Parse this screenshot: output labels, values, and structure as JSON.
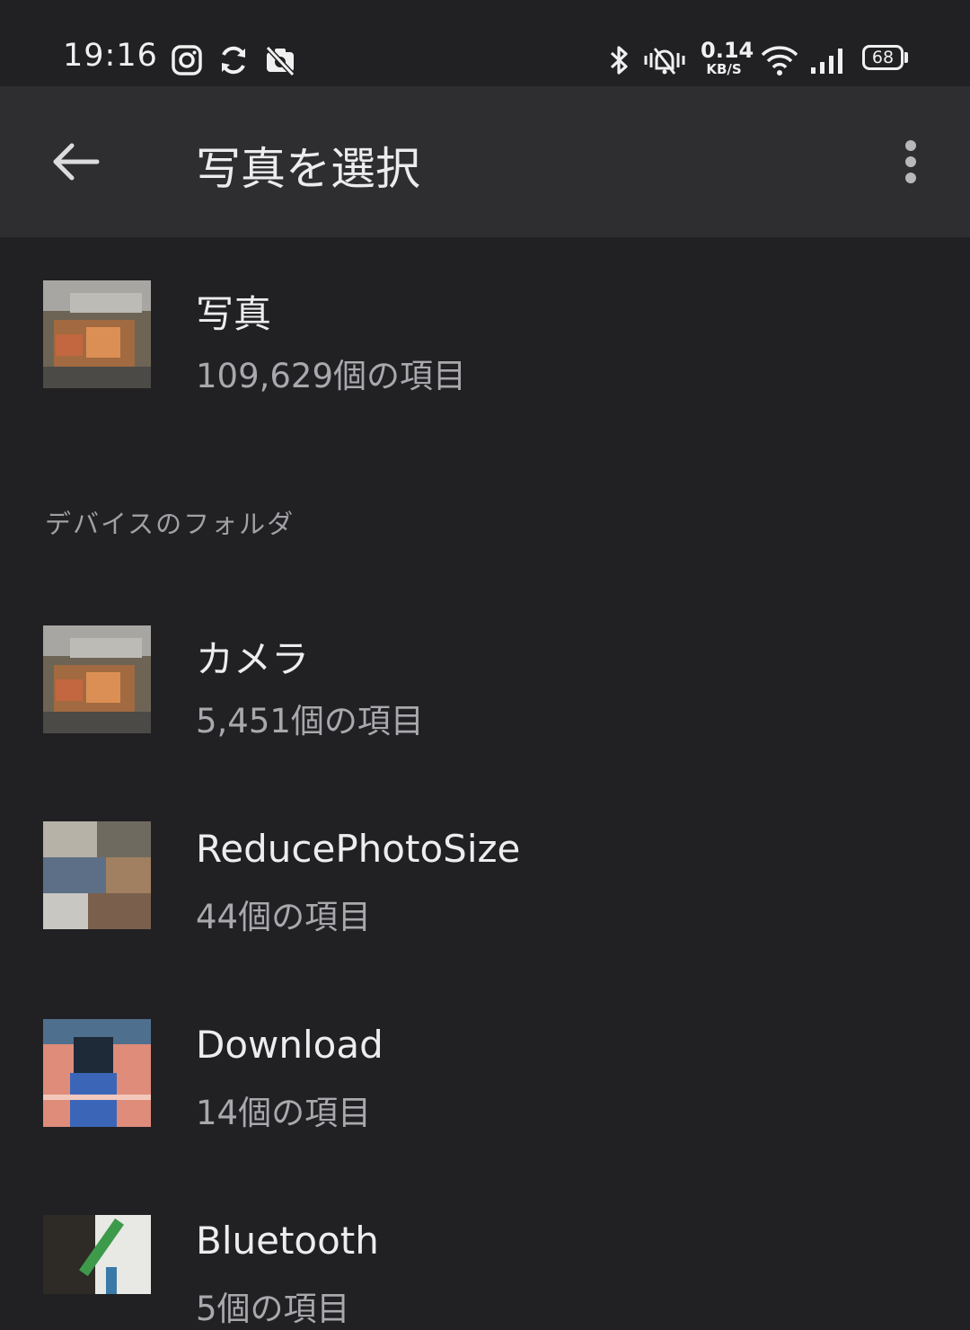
{
  "status_bar": {
    "time": "19:16",
    "left_icons": [
      "instagram-icon",
      "sync-icon",
      "no-camera-icon"
    ],
    "right_icons": [
      "bluetooth-icon",
      "vibrate-mute-icon",
      "wifi-icon",
      "cell-signal-icon",
      "battery-icon"
    ],
    "net_speed_value": "0.14",
    "net_speed_unit": "KB/S",
    "battery_level": "68"
  },
  "app_bar": {
    "back_icon": "back-arrow-icon",
    "title": "写真を選択",
    "menu_icon": "more-vert-icon"
  },
  "all_photos": {
    "title": "写真",
    "count": "109,629個の項目"
  },
  "section_header": "デバイスのフォルダ",
  "folders": [
    {
      "title": "カメラ",
      "count": "5,451個の項目"
    },
    {
      "title": "ReducePhotoSize",
      "count": "44個の項目"
    },
    {
      "title": "Download",
      "count": "14個の項目"
    },
    {
      "title": "Bluetooth",
      "count": "5個の項目"
    }
  ],
  "colors": {
    "background": "#212124",
    "app_bar": "#2e2e31",
    "primary_text": "#ededef",
    "secondary_text": "#a9a9ad"
  }
}
